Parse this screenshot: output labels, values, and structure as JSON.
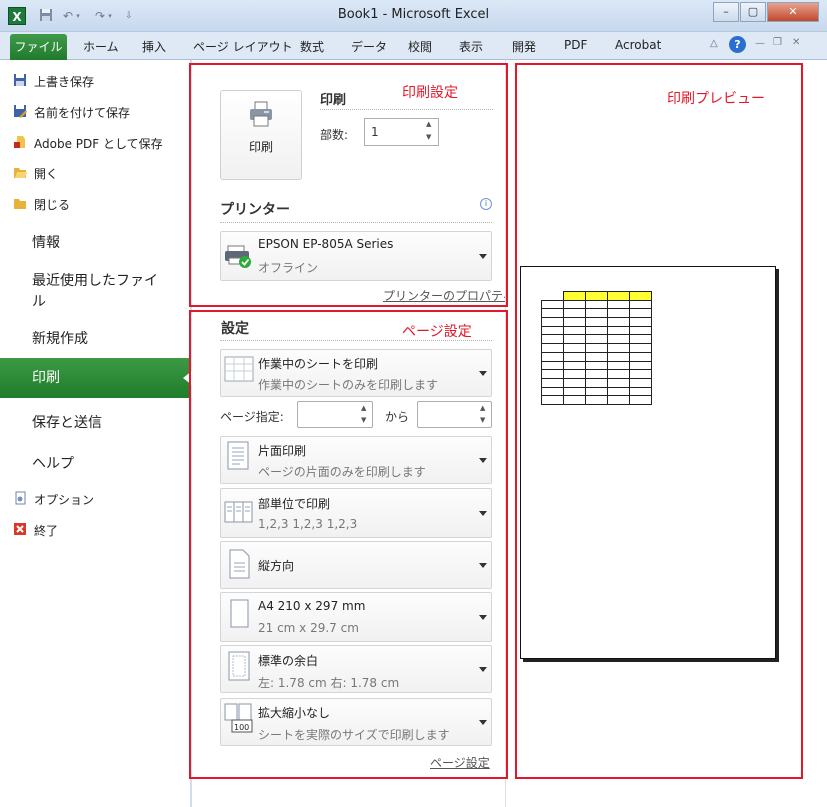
{
  "window": {
    "title": "Book1 - Microsoft Excel",
    "app_icon": "X",
    "controls": [
      "–",
      "▢",
      "✕"
    ]
  },
  "ribbon": {
    "file_tab": "ファイル",
    "tabs": [
      "ホーム",
      "挿入",
      "ページ レイアウト",
      "数式",
      "データ",
      "校閲",
      "表示",
      "開発",
      "PDF",
      "Acrobat"
    ]
  },
  "nav": {
    "small_items": [
      "上書き保存",
      "名前を付けて保存",
      "Adobe PDF として保存",
      "開く",
      "閉じる"
    ],
    "info": "情報",
    "recent_line1": "最近使用したファイ",
    "recent_line2": "ル",
    "new": "新規作成",
    "print": "印刷",
    "save_send": "保存と送信",
    "help": "ヘルプ",
    "options": "オプション",
    "exit": "終了"
  },
  "print": {
    "button_label": "印刷",
    "section_title": "印刷",
    "copies_label": "部数:",
    "copies_value": "1"
  },
  "printer": {
    "title": "プリンター",
    "name": "EPSON EP-805A Series",
    "status": "オフライン",
    "properties_link": "プリンターのプロパティ"
  },
  "settings": {
    "title": "設定",
    "what_main": "作業中のシートを印刷",
    "what_sub": "作業中のシートのみを印刷します",
    "pages_label": "ページ指定:",
    "to_label": "から",
    "sides_main": "片面印刷",
    "sides_sub": "ページの片面のみを印刷します",
    "collate_main": "部単位で印刷",
    "collate_sub": "1,2,3    1,2,3    1,2,3",
    "orientation_main": "縦方向",
    "paper_main": "A4 210 x 297 mm",
    "paper_sub": "21 cm x 29.7 cm",
    "margins_main": "標準の余白",
    "margins_sub": "左:  1.78 cm    右:  1.78 cm",
    "scaling_main": "拡大縮小なし",
    "scaling_sub": "シートを実際のサイズで印刷します",
    "scaling_icon_text": "100",
    "page_setup_link": "ページ設定"
  },
  "annotations": {
    "print_settings": "印刷設定",
    "page_settings": "ページ設定",
    "print_preview": "印刷プレビュー"
  },
  "colors": {
    "accent_green": "#2a8a35",
    "annotation_red": "#e2182a",
    "header_yellow": "#ffff33"
  }
}
